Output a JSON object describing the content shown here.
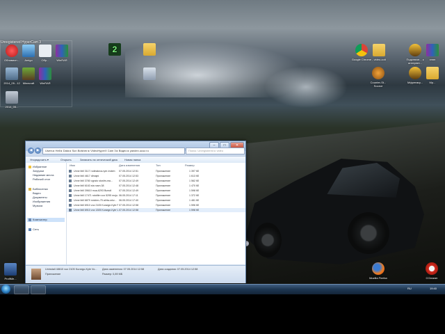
{
  "window_title": "Unregistered HyperCam 3",
  "desktop": {
    "icons_left": [
      {
        "label": "Обливион..."
      },
      {
        "label": "Amigo"
      },
      {
        "label": "Обр..."
      },
      {
        "label": "WinRAR"
      },
      {
        "label": "2014_05...12"
      },
      {
        "label": "Minecraft"
      },
      {
        "label": "WinRAR"
      },
      {
        "label": "2014_05..."
      }
    ],
    "icons_middle": [
      {
        "label": "2"
      },
      {
        "label": ""
      },
      {
        "label": ""
      }
    ],
    "icons_right": [
      {
        "label": "Google Chrome"
      },
      {
        "label": "- video-colt"
      },
      {
        "label": "Counter-St... Source"
      },
      {
        "label": "Подключе... к интернет..."
      },
      {
        "label": "xmm"
      },
      {
        "label": "Mp..."
      },
      {
        "label": "Мфрегмку..."
      }
    ],
    "icons_bottom": [
      {
        "label": "ProfiMe..."
      },
      {
        "label": "Mozilla Firefox"
      },
      {
        "label": "CCleaner"
      }
    ]
  },
  "explorer": {
    "address": "Users ▸ Hell ▸ Data ▸ Sun Bolshev ▸ VideoHyperX Cam 3 ▸ Видео ▸ yandex.ucoz.ru",
    "search_placeholder": "Поиск: Unregistered ▸ video",
    "toolbar": [
      "Упорядочить ▾",
      "Открыть",
      "Записать на оптический диск",
      "Новая папка"
    ],
    "nav": {
      "favorites_header": "Избранное",
      "favorites": [
        "Загрузки",
        "Недавние места",
        "Рабочий стол"
      ],
      "libraries_header": "Библиотеки",
      "libraries": [
        "Видео",
        "Документы",
        "Изображения",
        "Музыка"
      ],
      "computer": "Компьютер",
      "network": "Сеть"
    },
    "columns": [
      "Имя",
      "Дата изменения",
      "Тип",
      "Размер"
    ],
    "files": [
      {
        "name": "Unne ibill 3117 rodinalova-ryer-trokim",
        "date": "07.05.2014 12:51",
        "type": "Приложение",
        "size": "1 397 КБ"
      },
      {
        "name": "Unne ibill 4617 dlmajni",
        "date": "07.05.2014 12:53",
        "type": "Приложение",
        "size": "1 613 КБ"
      },
      {
        "name": "Unne ibill 3780 vypsto stosfm-ma...",
        "date": "07.05.2014 12:49",
        "type": "Приложение",
        "size": "1 562 КБ"
      },
      {
        "name": "Unne ibill 6163 sta rosm.38",
        "date": "07.05.2014 12:48",
        "type": "Приложение",
        "size": "1 470 КБ"
      },
      {
        "name": "Unne ibill 39610 mua-6293 Bursdi",
        "date": "07.05.2014 12:49",
        "type": "Приложение",
        "size": "1 598 КБ"
      },
      {
        "name": "Unne ibill 17471 rotofilm vox 5295 mojo...",
        "date": "06.05.2014 17:11",
        "type": "Приложение",
        "size": "1 372 КБ"
      },
      {
        "name": "Unne ibill 6879 mrizbm-75 at/rta-srkv...",
        "date": "06.05.2014 17:40",
        "type": "Приложение",
        "size": "1 481 КБ"
      },
      {
        "name": "Unne ibill 6910 voz 2105 Kurarge-Kyle Fi...",
        "date": "07.05.2014 12:58",
        "type": "Приложение",
        "size": "1 596 КБ"
      },
      {
        "name": "Unne ibill 6910 voz 1305 Kurarge-Kyle Vo...",
        "date": "07.05.2014 12:58",
        "type": "Приложение",
        "size": "1 598 КБ"
      }
    ],
    "details": {
      "name": "Uninstall 48610 voz 2105 Kurargo-Kyle Vo...",
      "modified": "Дата изменения: 07.05.2014 12:58",
      "type": "Приложение",
      "size": "Размер: 0,89 МБ",
      "created": "Дата создания: 07.05.2014 12:58"
    }
  },
  "taskbar": {
    "lang": "RU",
    "clock": "19:40"
  }
}
